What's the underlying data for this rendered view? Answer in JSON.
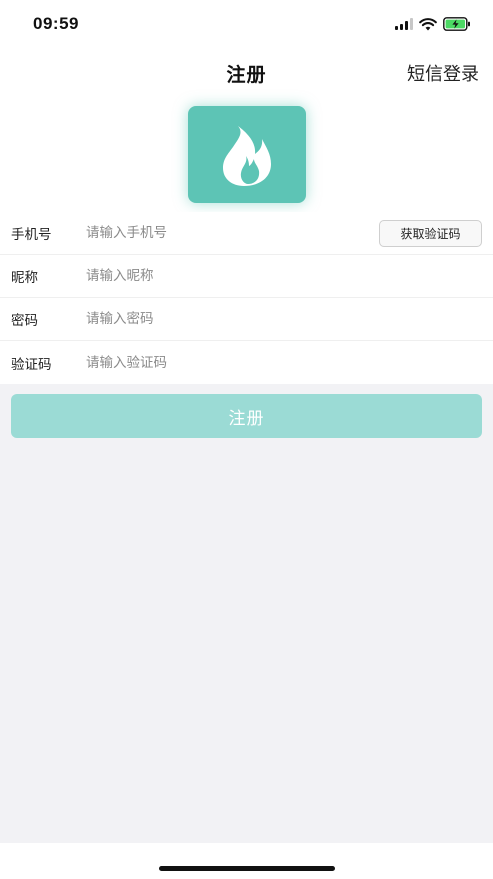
{
  "status_bar": {
    "time": "09:59",
    "icons": [
      "signal-icon",
      "wifi-icon",
      "battery-charging-icon"
    ]
  },
  "nav": {
    "title": "注册",
    "right_link": "短信登录"
  },
  "logo": {
    "icon": "flame-icon",
    "color": "#5dc4b5"
  },
  "form": {
    "phone": {
      "label": "手机号",
      "placeholder": "请输入手机号",
      "value": ""
    },
    "nickname": {
      "label": "昵称",
      "placeholder": "请输入昵称",
      "value": ""
    },
    "password": {
      "label": "密码",
      "placeholder": "请输入密码",
      "value": ""
    },
    "code": {
      "label": "验证码",
      "placeholder": "请输入验证码",
      "value": ""
    },
    "get_code_label": "获取验证码"
  },
  "submit": {
    "label": "注册",
    "color": "#9bdbd5"
  }
}
